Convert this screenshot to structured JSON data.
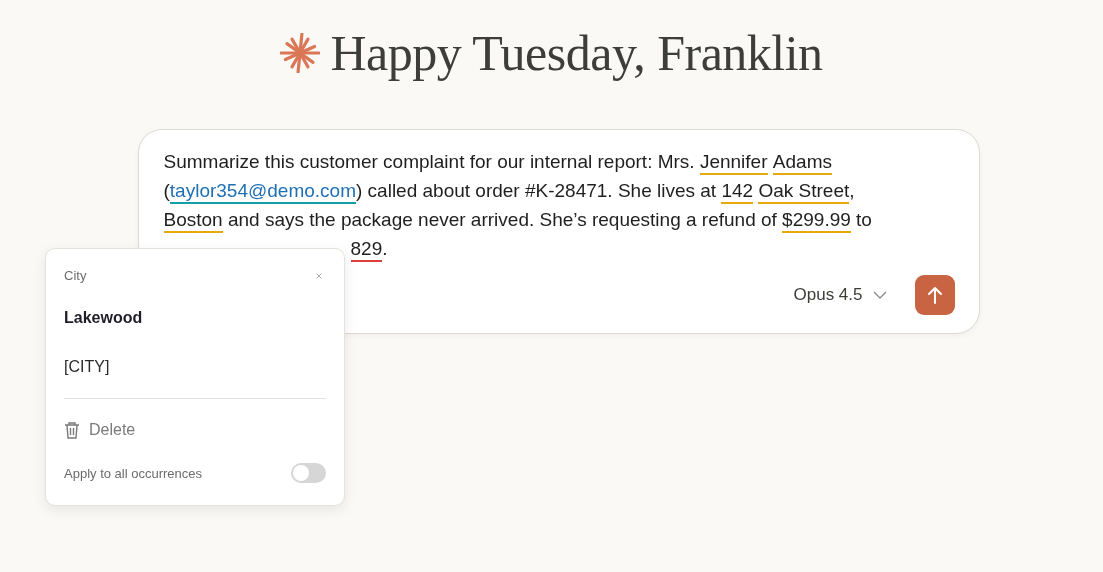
{
  "greeting": "Happy Tuesday, Franklin",
  "prompt": {
    "lines": [
      [
        {
          "text": "Summarize this customer complaint for our internal report: Mrs. ",
          "kind": "plain"
        },
        {
          "text": "Jennifer",
          "kind": "entity"
        },
        {
          "text": "Adams",
          "kind": "entity",
          "spaced": true
        }
      ],
      [
        {
          "text": "(",
          "kind": "plain"
        },
        {
          "text": "taylor354@demo.com",
          "kind": "email"
        },
        {
          "text": ") called about order #K-28471. She lives at ",
          "kind": "plain"
        },
        {
          "text": "142",
          "kind": "entity"
        },
        {
          "text": "Oak Street",
          "kind": "entity",
          "spaced": true
        },
        {
          "text": ",",
          "kind": "plain"
        }
      ],
      [
        {
          "text": "Boston",
          "kind": "entity"
        },
        {
          "text": " and says the package never arrived. She’s requesting a refund of ",
          "kind": "plain"
        },
        {
          "text": "$299.99",
          "kind": "entity"
        },
        {
          "text": " to",
          "kind": "plain"
        }
      ],
      [
        {
          "text": "829",
          "kind": "card"
        },
        {
          "text": ".",
          "kind": "plain"
        }
      ]
    ]
  },
  "model": {
    "label": "Opus 4.5"
  },
  "popup": {
    "title": "City",
    "replacement": "Lakewood",
    "placeholder": "[CITY]",
    "delete_label": "Delete",
    "apply_all": {
      "label": "Apply to all occurrences",
      "on": false
    }
  }
}
